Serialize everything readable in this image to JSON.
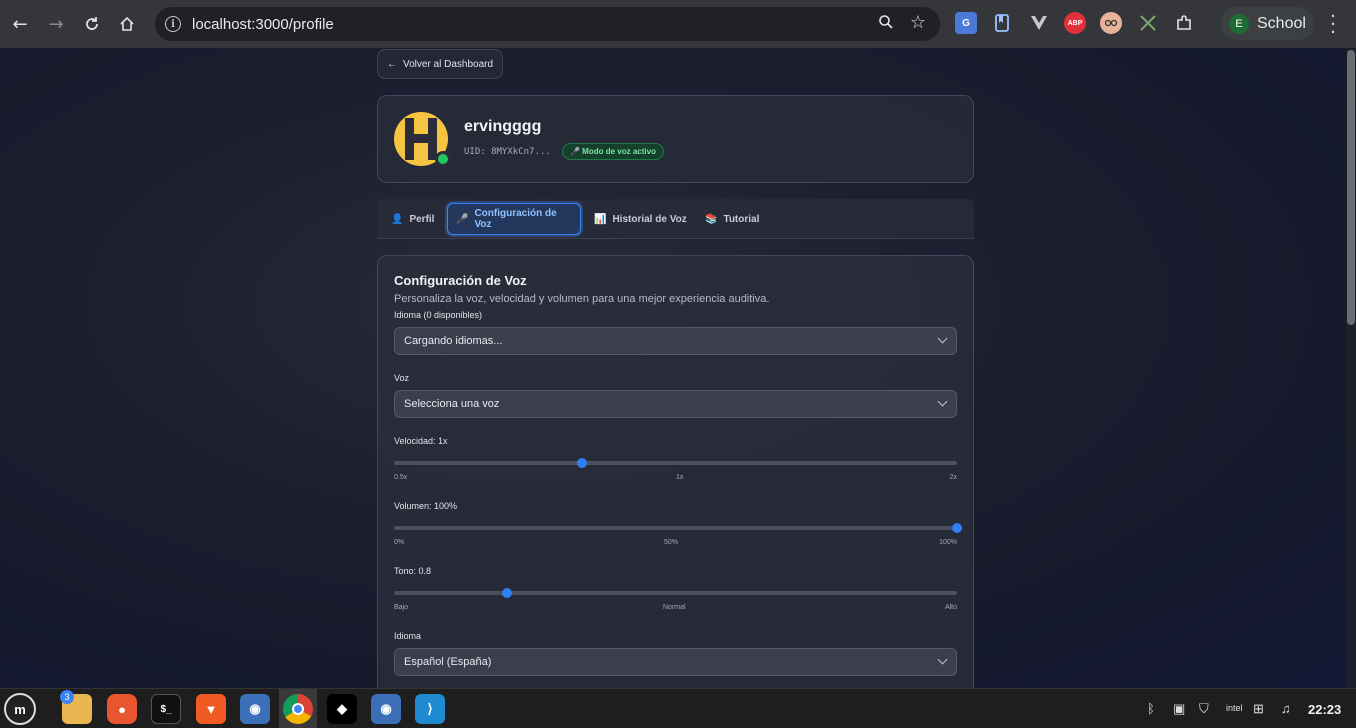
{
  "browser": {
    "url": "localhost:3000/profile",
    "profile_initial": "E",
    "profile_name": "School",
    "extensions": [
      "google-translate-icon",
      "bookmark-icon",
      "vue-devtools-icon",
      "adblock-plus-icon",
      "avatar-extension-icon",
      "puzzle-icon"
    ],
    "abp_label": "ABP"
  },
  "page": {
    "back_label": "Volver al Dashboard",
    "back_arrow": "←",
    "user": {
      "name": "ervingggg",
      "uid": "UID: 8MYXkCn7...",
      "voice_badge": "🎤 Modo de voz activo",
      "status": "online"
    },
    "tabs": [
      {
        "icon": "👤",
        "label": "Perfil"
      },
      {
        "icon": "🎤",
        "label": "Configuración de Voz",
        "active": true
      },
      {
        "icon": "📊",
        "label": "Historial de Voz"
      },
      {
        "icon": "📚",
        "label": "Tutorial"
      }
    ],
    "settings": {
      "title": "Configuración de Voz",
      "subtitle": "Personaliza la voz, velocidad y volumen para una mejor experiencia auditiva.",
      "language_label": "Idioma (0 disponibles)",
      "language_value": "Cargando idiomas...",
      "voice_label": "Voz",
      "voice_value": "Selecciona una voz",
      "speed": {
        "label": "Velocidad: 1x",
        "value": 1,
        "min_label": "0.5x",
        "mid_label": "1x",
        "max_label": "2x",
        "fraction": 0.3333
      },
      "volume": {
        "label": "Volumen: 100%",
        "value": 100,
        "min_label": "0%",
        "mid_label": "50%",
        "max_label": "100%",
        "fraction": 1.0
      },
      "pitch": {
        "label": "Tono: 0.8",
        "value": 0.8,
        "min_label": "Bajo",
        "mid_label": "Normal",
        "max_label": "Alto",
        "fraction": 0.2
      },
      "idioma_label": "Idioma",
      "idioma_value": "Español (España)"
    }
  },
  "taskbar": {
    "files_badge": "3",
    "clock": "22:23",
    "accent": "#3b82f6"
  }
}
